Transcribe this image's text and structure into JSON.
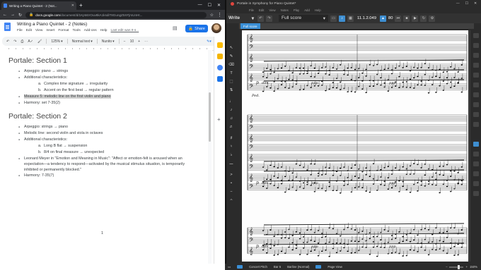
{
  "browser": {
    "tab_title": "Writing a Piano Quintet - 2 (Not...",
    "url_host": "docs.google.com",
    "url_path": "/document/d/1KpMzrOuv8kA1ksdiT8GungZ5XFjmUnHt...",
    "new_tab": "+"
  },
  "doc": {
    "title": "Writing a Piano Quintet - 2 (Notes)",
    "menus": [
      "File",
      "Edit",
      "View",
      "Insert",
      "Format",
      "Tools",
      "Add-ons",
      "Help"
    ],
    "last_edit": "Last edit was 9 s...",
    "share_label": "Share",
    "toolbar": {
      "zoom": "125%",
      "style": "Normal text",
      "font": "Nunito",
      "size": "10"
    },
    "section1": {
      "heading": "Portale: Section 1",
      "arpeggio": "Arpeggio: piano → strings",
      "additional": "Additional characteristics:",
      "sub": [
        {
          "marker": "a.",
          "text": "Complex time signature → irregularity"
        },
        {
          "marker": "b.",
          "text": "Accent on the first beat → regular pattern"
        }
      ],
      "measure": "Measure 5: melodic line on the first violin and piano",
      "harmony": "Harmony: set 7-35(2)"
    },
    "section2": {
      "heading": "Portale: Section 2",
      "arpeggio": "Arpeggio: strings → piano",
      "melodic": "Melodic line: second violin and viola in octaves",
      "additional": "Additional characteristics:",
      "sub": [
        {
          "marker": "a.",
          "text": "Long B flat → suspension"
        },
        {
          "marker": "b.",
          "text": "8/4 on final measure → unexpected"
        }
      ],
      "quote": "Leonard Meyer in \"Emotion and Meaning in Music\": \"Affect or emotion-felt is aroused when an expectation—a tendency to respond—activated by the musical stimulus situation, is temporarily inhibited or permanently blocked.\"",
      "harmony": "Harmony: 7-35(7)"
    },
    "page_number": "1"
  },
  "sibelius": {
    "window_title": "Portale in Symphony for Piano Quintet*",
    "menus": [
      "File",
      "Edit",
      "View",
      "Notes",
      "Play",
      "Add",
      "Help"
    ],
    "mode": "Write",
    "view": "Full score",
    "timecode": "11.1.2.049",
    "tempo": "80",
    "score_tab": "Full score",
    "markings": {
      "dynamic_p": "p",
      "dynamic_ppp": "ppp",
      "dim": "dim.",
      "ped": "Ped."
    },
    "status": {
      "concert_pitch": "Concert Pitch",
      "bar": "Bar 5",
      "barline": "Barline (Normal)",
      "page_view": "Page View",
      "zoom": "150%"
    }
  },
  "colors": {
    "docs_blue": "#1a73e8",
    "sibelius_accent": "#3e8ed0",
    "highlight": "#d2d2d2"
  }
}
